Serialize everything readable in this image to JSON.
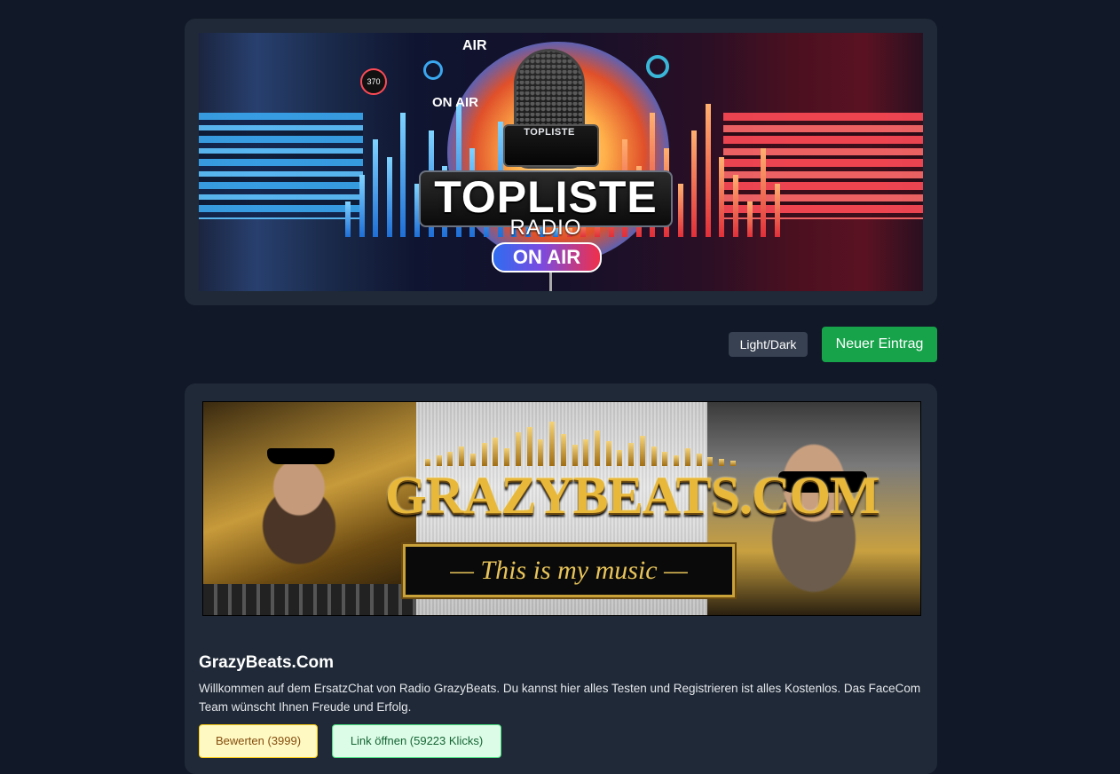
{
  "header_banner": {
    "logo_title": "TOPLISTE",
    "logo_subtitle": "RADIO",
    "badge": "ON AIR",
    "air_text": "AIR",
    "on_air_small": "ON AIR",
    "mic_label": "TOPLISTE",
    "dial_value": "370"
  },
  "toolbar": {
    "theme_toggle_label": "Light/Dark",
    "new_entry_label": "Neuer Eintrag"
  },
  "entry": {
    "banner": {
      "brand_text": "GRAZYBEATS.COM",
      "slogan": "— This is my music —"
    },
    "title": "GrazyBeats.Com",
    "description": "Willkommen auf dem ErsatzChat von Radio GrazyBeats. Du kannst hier alles Testen und Registrieren ist alles Kostenlos. Das FaceCom Team wünscht Ihnen Freude und Erfolg.",
    "rate_button_label": "Bewerten (3999)",
    "open_link_button_label": "Link öffnen (59223 Klicks)"
  },
  "colors": {
    "page_background": "#111827",
    "card_background": "#1f2937",
    "new_entry_button": "#16a34a",
    "theme_button": "#374151",
    "rate_button": "#fef9c3",
    "open_button": "#dcfce7"
  }
}
